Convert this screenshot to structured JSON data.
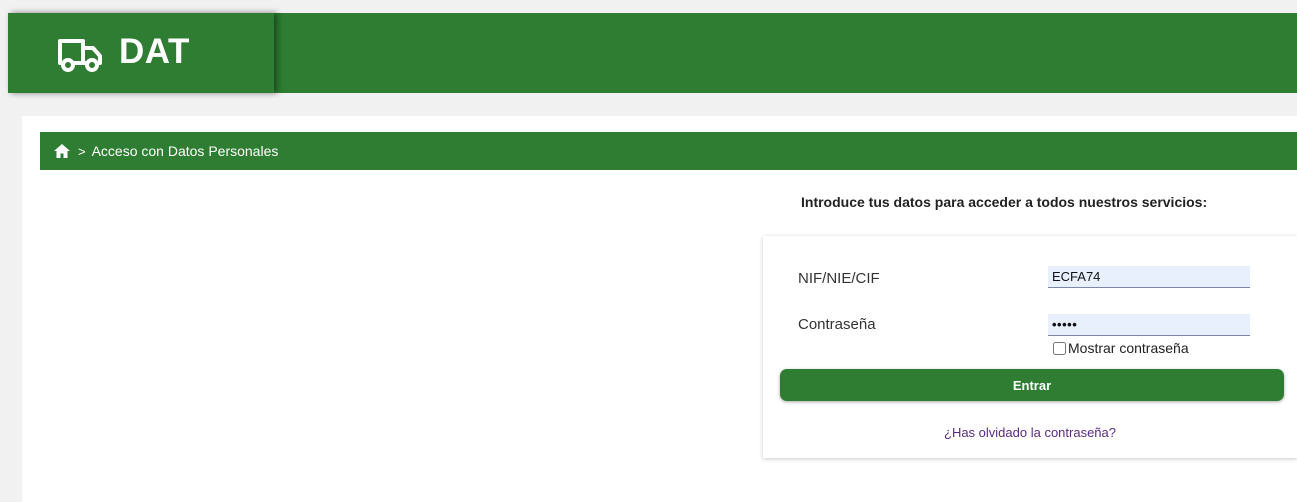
{
  "header": {
    "brand": "DAT",
    "brand_icon": "truck-icon",
    "colors": {
      "primary": "#2e7d32",
      "link": "#5b2a86",
      "input_bg": "#e8f0fe"
    }
  },
  "breadcrumb": {
    "home_icon": "home-icon",
    "separator": ">",
    "current": "Acceso con Datos Personales"
  },
  "login": {
    "intro": "Introduce tus datos para acceder a todos nuestros servicios:",
    "nif_label": "NIF/NIE/CIF",
    "nif_value": "ECFA74",
    "password_label": "Contraseña",
    "password_value": "•••••",
    "show_password_label": "Mostrar contraseña",
    "show_password_checked": false,
    "submit_label": "Entrar",
    "forgot_label": "¿Has olvidado la contraseña?"
  }
}
